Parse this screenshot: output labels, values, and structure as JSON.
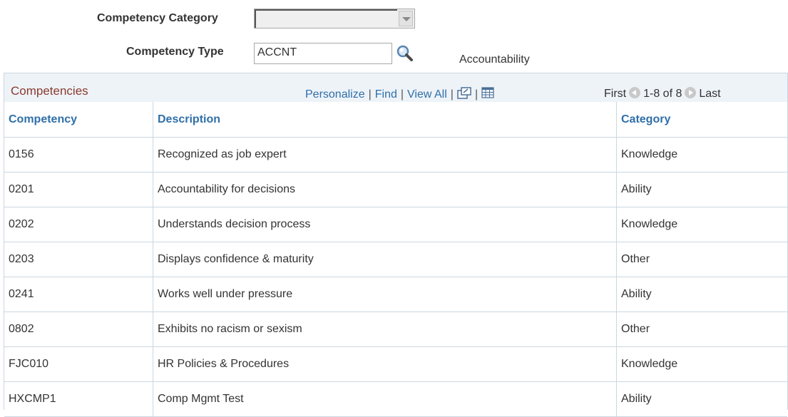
{
  "filters": {
    "category_label": "Competency Category",
    "category_value": "",
    "type_label": "Competency Type",
    "type_value": "ACCNT",
    "type_description": "Accountability",
    "lookup_icon": "magnifier-icon",
    "dropdown_icon": "chevron-down-icon"
  },
  "grid": {
    "title": "Competencies",
    "links": {
      "personalize": "Personalize",
      "find": "Find",
      "view_all": "View All"
    },
    "icons": [
      "new-window-icon",
      "download-spreadsheet-icon"
    ],
    "pager": {
      "first": "First",
      "range": "1-8 of 8",
      "last": "Last"
    },
    "columns": [
      "Competency",
      "Description",
      "Category"
    ],
    "rows": [
      [
        "0156",
        "Recognized as job expert",
        "Knowledge"
      ],
      [
        "0201",
        "Accountability for decisions",
        "Ability"
      ],
      [
        "0202",
        "Understands decision process",
        "Knowledge"
      ],
      [
        "0203",
        "Displays confidence & maturity",
        "Other"
      ],
      [
        "0241",
        "Works well under pressure",
        "Ability"
      ],
      [
        "0802",
        "Exhibits no racism or sexism",
        "Other"
      ],
      [
        "FJC010",
        "HR Policies & Procedures",
        "Knowledge"
      ],
      [
        "HXCMP1",
        "Comp Mgmt Test",
        "Ability"
      ]
    ]
  }
}
